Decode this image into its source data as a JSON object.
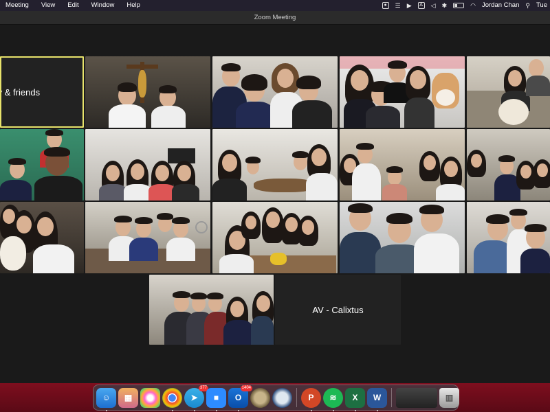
{
  "menubar": {
    "items": [
      "Meeting",
      "View",
      "Edit",
      "Window",
      "Help"
    ],
    "user": "Jordan Chan",
    "day": "Tue",
    "status_icons": [
      "screen-record-icon",
      "notes-icon",
      "play-icon",
      "a-icon",
      "mute-icon",
      "bluetooth-icon",
      "battery-icon",
      "wifi-icon",
      "search-icon"
    ]
  },
  "window": {
    "title": "Zoom Meeting"
  },
  "participants": {
    "active_name": "rry & friends",
    "av_name": "AV - Calixtus"
  },
  "dock": {
    "apps": [
      {
        "name": "finder-icon",
        "badge": ""
      },
      {
        "name": "launchpad-icon",
        "badge": ""
      },
      {
        "name": "photos-icon",
        "badge": ""
      },
      {
        "name": "chrome-icon",
        "badge": ""
      },
      {
        "name": "telegram-icon",
        "badge": "377"
      },
      {
        "name": "zoom-icon",
        "badge": ""
      },
      {
        "name": "outlook-icon",
        "badge": "1404"
      },
      {
        "name": "book-icon",
        "badge": ""
      },
      {
        "name": "ship-icon",
        "badge": ""
      },
      {
        "name": "powerpoint-icon",
        "badge": ""
      },
      {
        "name": "spotify-icon",
        "badge": ""
      },
      {
        "name": "excel-icon",
        "badge": ""
      },
      {
        "name": "word-icon",
        "badge": ""
      },
      {
        "name": "window-preview-icon",
        "badge": ""
      },
      {
        "name": "trash-icon",
        "badge": ""
      }
    ]
  }
}
